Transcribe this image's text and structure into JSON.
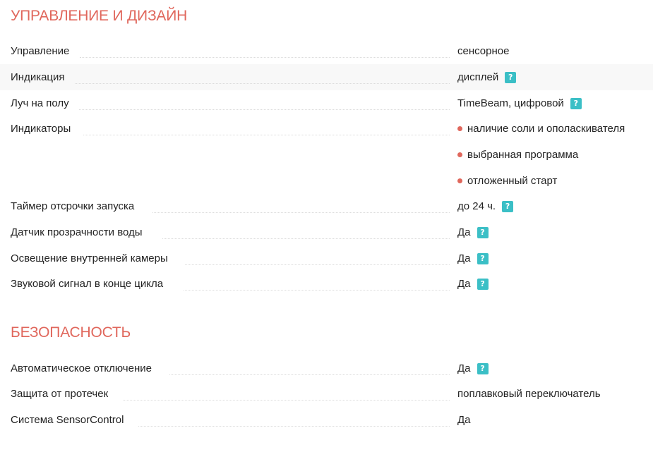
{
  "sections": [
    {
      "title": "УПРАВЛЕНИЕ И ДИЗАЙН",
      "rows": [
        {
          "label": "Управление",
          "value": "сенсорное"
        },
        {
          "label": "Индикация",
          "value": "дисплей",
          "help": "?"
        },
        {
          "label": "Луч на полу",
          "value": "TimeBeam, цифровой",
          "help": "?"
        },
        {
          "label": "Индикаторы",
          "bullets": [
            "наличие соли и ополаскивателя",
            "выбранная программа",
            "отложенный старт"
          ]
        },
        {
          "label": "Таймер отсрочки запуска",
          "value": "до 24 ч.",
          "help": "?"
        },
        {
          "label": "Датчик прозрачности воды",
          "value": "Да",
          "help": "?"
        },
        {
          "label": "Освещение внутренней камеры",
          "value": "Да",
          "help": "?"
        },
        {
          "label": "Звуковой сигнал в конце цикла",
          "value": "Да",
          "help": "?"
        }
      ]
    },
    {
      "title": "БЕЗОПАСНОСТЬ",
      "rows": [
        {
          "label": "Автоматическое отключение",
          "value": "Да",
          "help": "?"
        },
        {
          "label": "Защита от протечек",
          "value": "поплавковый переключатель"
        },
        {
          "label": "Система SensorControl",
          "value": "Да"
        }
      ]
    }
  ],
  "colors": {
    "accent": "#e0675c",
    "help_badge": "#3bbfc6",
    "row_shade": "#f8f8f8"
  }
}
